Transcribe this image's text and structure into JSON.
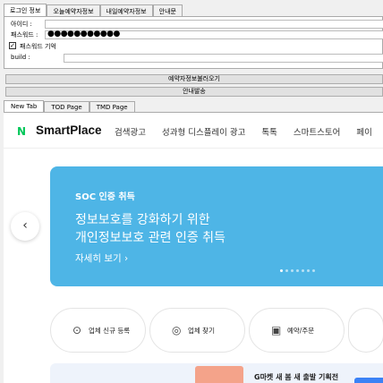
{
  "top_tabs": [
    "로그인 정보",
    "오늘예약자정보",
    "내일예약자정보",
    "안내문"
  ],
  "login": {
    "id_label": "아이디 :",
    "id_value": "",
    "pw_label": "패스워드 :",
    "pw_value": "●●●●●●●●●●●",
    "remember_label": "패스워드 기억",
    "remember_checked": "✓",
    "build_label": "build :"
  },
  "buttons": {
    "load_reservations": "예약자정보불러오기",
    "send_notice": "안내발송"
  },
  "browser_tabs": [
    "New Tab",
    "TOD Page",
    "TMD Page"
  ],
  "site": {
    "logo_mark": "N",
    "brand": "SmartPlace",
    "nav": [
      "검색광고",
      "성과형 디스플레이 광고",
      "톡톡",
      "스마트스토어",
      "페이"
    ],
    "banner": {
      "kicker": "SOC 인증 취득",
      "title_line1": "정보보호를 강화하기 위한",
      "title_line2": "개인정보보호 관련 인증 취득",
      "more": "자세히 보기 ›",
      "prev": "‹",
      "slide_count": 7,
      "active_slide": 1
    },
    "quick_links": [
      {
        "icon": "location-pin-icon",
        "label": "업체 신규 등록"
      },
      {
        "icon": "search-icon",
        "label": "업체 찾기"
      },
      {
        "icon": "calendar-check-icon",
        "label": "예약/주문"
      }
    ],
    "promo": {
      "text": "G마켓 새 봄 새 출발 기획전"
    }
  },
  "colors": {
    "brand_green": "#03c75a",
    "banner_blue": "#4eb5e6"
  }
}
